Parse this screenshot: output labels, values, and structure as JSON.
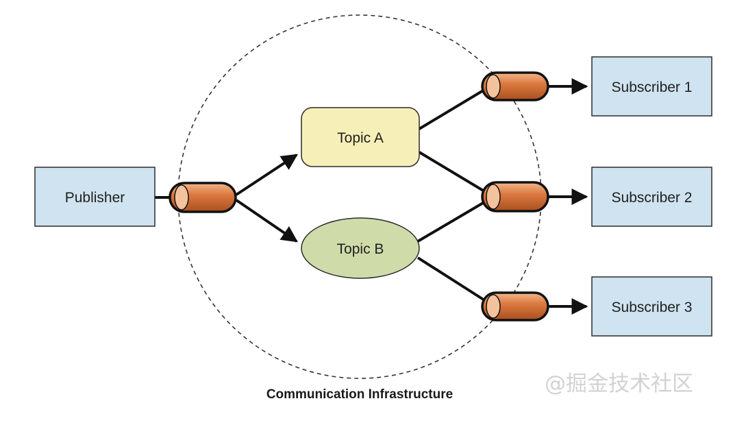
{
  "publisher": {
    "label": "Publisher"
  },
  "topics": [
    {
      "label": "Topic A"
    },
    {
      "label": "Topic B"
    }
  ],
  "subscribers": [
    {
      "label": "Subscriber 1"
    },
    {
      "label": "Subscriber 2"
    },
    {
      "label": "Subscriber 3"
    }
  ],
  "caption": "Communication Infrastructure",
  "watermark": "@掘金技术社区",
  "colors": {
    "box_fill": "#cfe3f0",
    "topic_a_fill": "#f7efb8",
    "topic_b_fill": "#cfdcaa",
    "channel_fill": "#d9743c",
    "line": "#111111"
  }
}
